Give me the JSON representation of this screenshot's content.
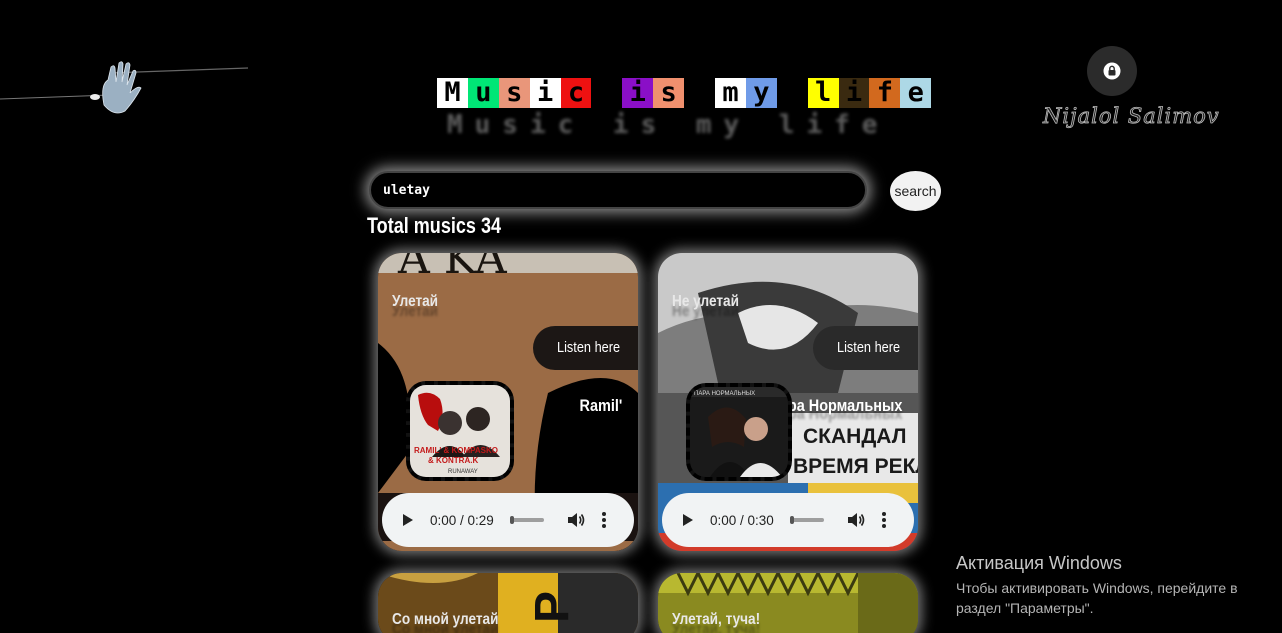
{
  "title": {
    "letters": [
      {
        "char": "M",
        "bg": "#ffffff"
      },
      {
        "char": "u",
        "bg": "#00e676"
      },
      {
        "char": "s",
        "bg": "#e9967a"
      },
      {
        "char": "i",
        "bg": "#ffffff"
      },
      {
        "char": "c",
        "bg": "#ee1111"
      },
      {
        "char": " ",
        "bg": "#000000"
      },
      {
        "char": "i",
        "bg": "#8a0fc7"
      },
      {
        "char": "s",
        "bg": "#f0906e"
      },
      {
        "char": " ",
        "bg": "#000000"
      },
      {
        "char": "m",
        "bg": "#ffffff"
      },
      {
        "char": "y",
        "bg": "#6f9be8"
      },
      {
        "char": " ",
        "bg": "#000000"
      },
      {
        "char": "l",
        "bg": "#ffff00"
      },
      {
        "char": "i",
        "bg": "#3a2a10"
      },
      {
        "char": "f",
        "bg": "#d2691e"
      },
      {
        "char": "e",
        "bg": "#add8e6"
      }
    ],
    "reflection": "Music is my life"
  },
  "header": {
    "lock_icon": "lock-icon",
    "signature": "Nijalol Salimov"
  },
  "search": {
    "value": "uletay",
    "button_label": "search"
  },
  "total_label": "Total musics 34",
  "cards": [
    {
      "title": "Улетай",
      "listen_label": "Listen here",
      "artist": "Ramil'",
      "cover_text": [
        "RAMIL' & KOMPASKO",
        "& KONTRA.K",
        "RUNAWAY"
      ],
      "time": "0:00 / 0:29",
      "bg": "#9b6b45"
    },
    {
      "title": "Не улетай",
      "listen_label": "Listen here",
      "artist": "Пара Нормальных",
      "cover_text": [
        "ПАРА НОРМАЛЬНЫХ"
      ],
      "time": "0:00 / 0:30",
      "bg": "#8a8a8a",
      "poster_lines": [
        "СКАНДАЛ",
        "ВРЕМЯ РЕКЛ"
      ]
    }
  ],
  "bottom_cards": [
    {
      "title": "Со мной улетай"
    },
    {
      "title": "Улетай, туча!"
    }
  ],
  "windows_activation": {
    "title": "Активация Windows",
    "line1": "Чтобы активировать Windows, перейдите в",
    "line2": "раздел \"Параметры\"."
  }
}
